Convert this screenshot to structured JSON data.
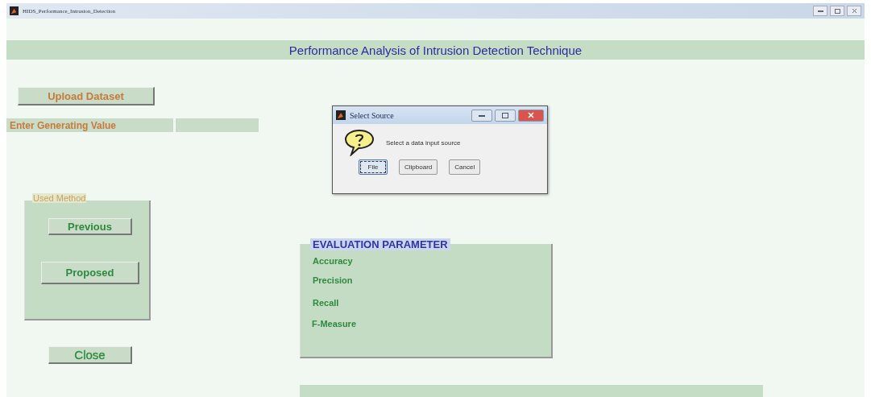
{
  "window": {
    "title": "HIDS_Performance_Intrusion_Detection"
  },
  "header": {
    "title": "Performance Analysis of Intrusion Detection Technique"
  },
  "upload_button": {
    "label": "Upload Dataset"
  },
  "generating_value": {
    "label": "Enter Generating Value"
  },
  "used_method": {
    "title": "Used Method",
    "buttons": [
      "Previous",
      "Proposed"
    ]
  },
  "close_button": {
    "label": "Close"
  },
  "evaluation": {
    "title": "EVALUATION PARAMETER",
    "parameters": [
      "Accuracy",
      "Precision",
      "Recall",
      "F-Measure"
    ]
  },
  "dialog": {
    "title": "Select Source",
    "message": "Select a data input source",
    "buttons": [
      {
        "label": "File",
        "selected": true
      },
      {
        "label": "Clipboard",
        "selected": false
      },
      {
        "label": "Cancel",
        "selected": false
      }
    ]
  }
}
